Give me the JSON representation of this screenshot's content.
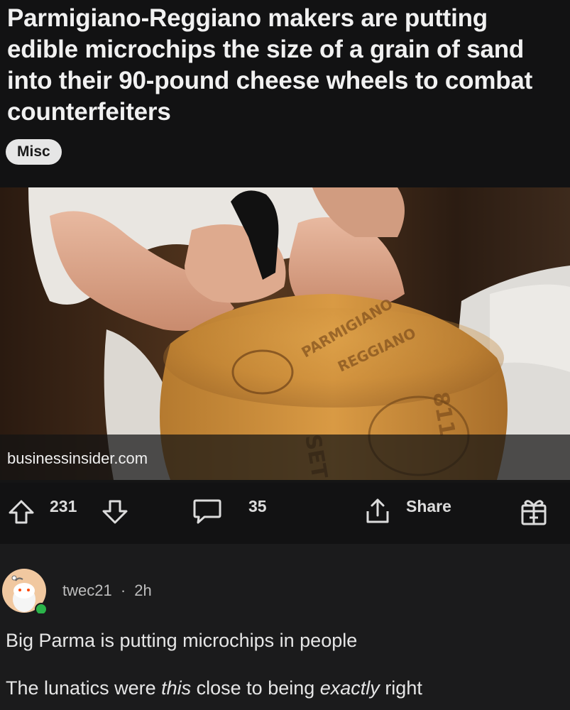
{
  "post": {
    "title": "Parmigiano-Reggiano makers are putting edible microchips the size of a grain of sand into their 90-pound cheese wheels to combat counterfeiters",
    "flair": "Misc",
    "link_domain": "businessinsider.com",
    "image_description_icon": "photo-cheese-wheel"
  },
  "actions": {
    "upvote_count": "231",
    "comment_count": "35",
    "share_label": "Share"
  },
  "comment": {
    "author": "twec21",
    "separator": "·",
    "age": "2h",
    "line1": "Big Parma is putting microchips in people",
    "line2_before": "The lunatics were ",
    "line2_em1": "this",
    "line2_mid": " close to being ",
    "line2_em2": "exactly",
    "line2_after": " right"
  },
  "colors": {
    "background": "#1b1b1c",
    "header_bg": "#121213",
    "flair_bg": "#e6e6e6",
    "online_dot": "#2bb44a",
    "avatar_bg": "#f1c8a0"
  }
}
